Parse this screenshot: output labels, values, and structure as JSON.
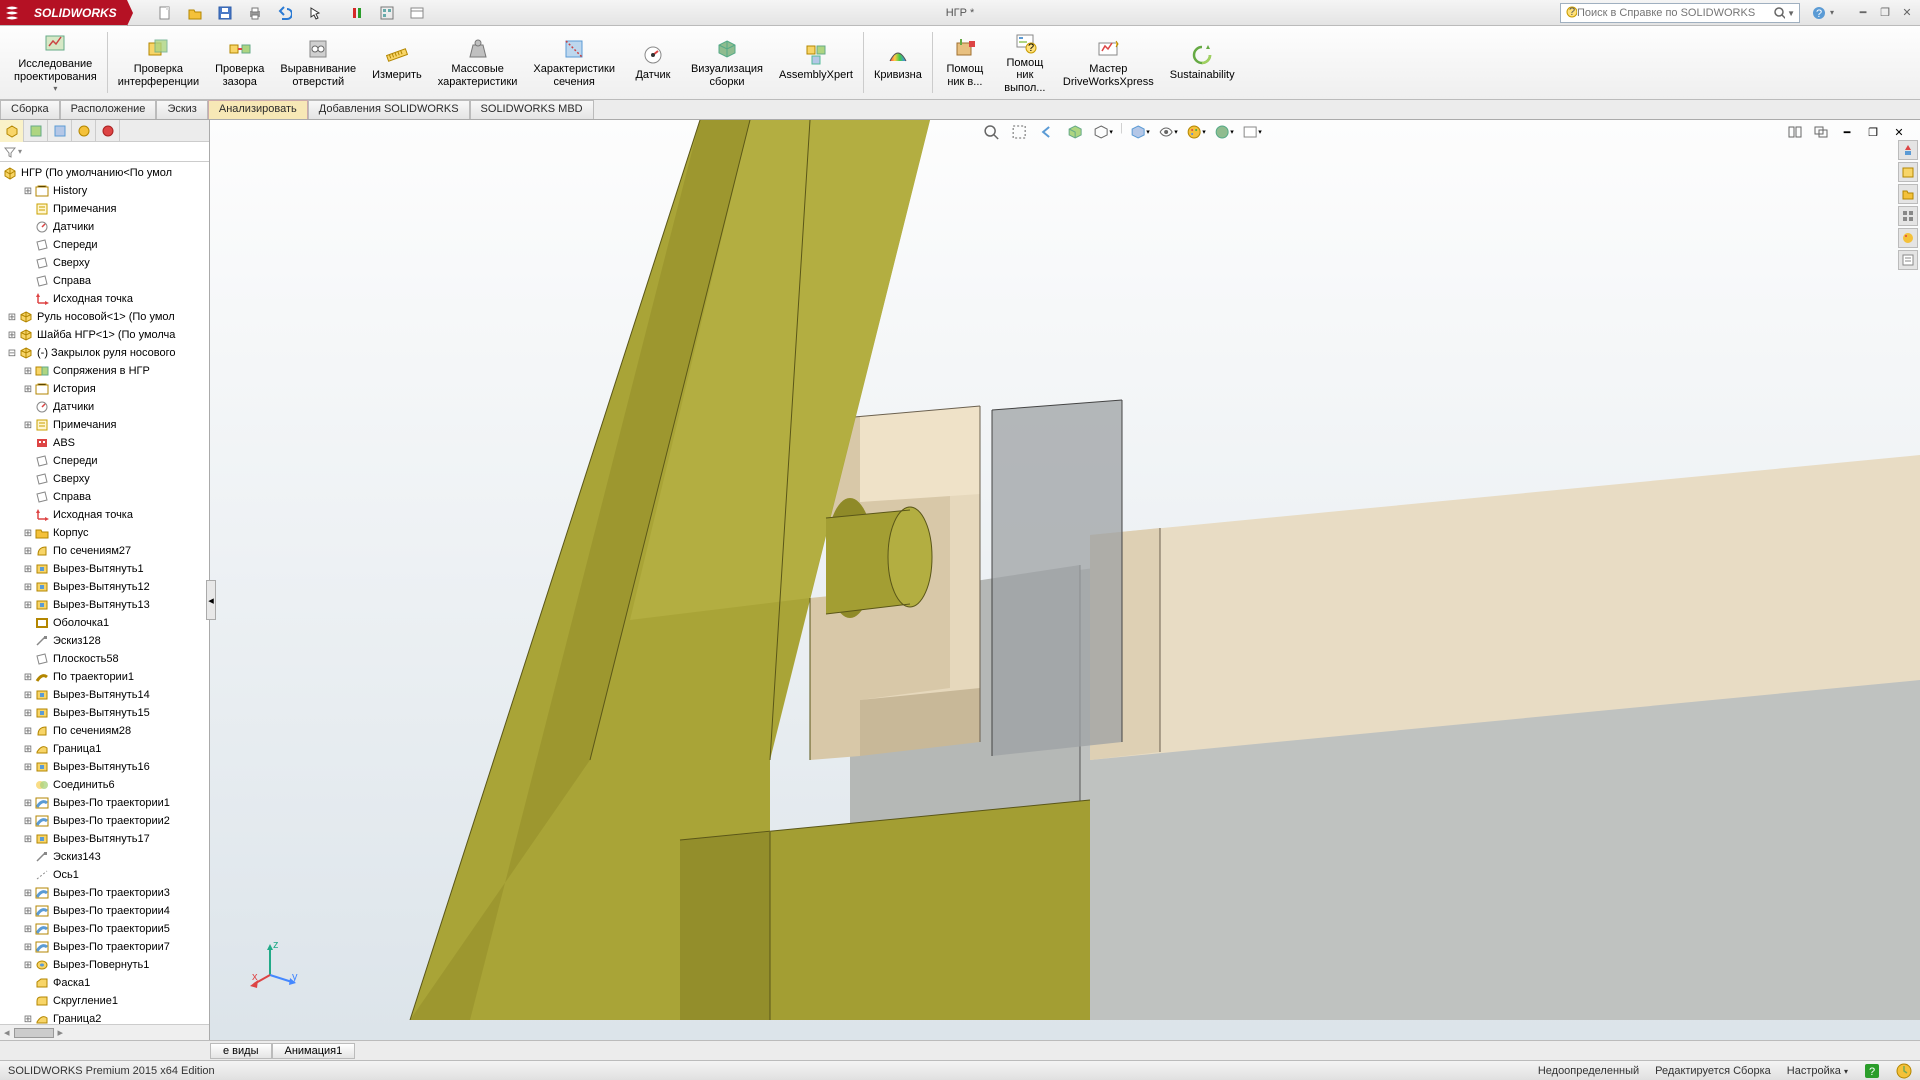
{
  "app": {
    "brand": "SOLIDWORKS",
    "doc_title": "НГР *"
  },
  "search": {
    "placeholder": "Поиск в Справке по SOLIDWORKS"
  },
  "ribbon": {
    "items": [
      {
        "label1": "Исследование",
        "label2": "проектирования",
        "icon": "design-study"
      },
      {
        "label1": "Проверка",
        "label2": "интерференции",
        "icon": "interference"
      },
      {
        "label1": "Проверка",
        "label2": "зазора",
        "icon": "clearance"
      },
      {
        "label1": "Выравнивание",
        "label2": "отверстий",
        "icon": "hole-align"
      },
      {
        "label1": "Измерить",
        "label2": "",
        "icon": "measure"
      },
      {
        "label1": "Массовые",
        "label2": "характеристики",
        "icon": "mass"
      },
      {
        "label1": "Характеристики",
        "label2": "сечения",
        "icon": "section"
      },
      {
        "label1": "Датчик",
        "label2": "",
        "icon": "sensor"
      },
      {
        "label1": "Визуализация",
        "label2": "сборки",
        "icon": "visualize"
      },
      {
        "label1": "AssemblyXpert",
        "label2": "",
        "icon": "asmxpert"
      },
      {
        "label1": "Кривизна",
        "label2": "",
        "icon": "curvature"
      },
      {
        "label1": "Помощ",
        "label2": "ник в...",
        "icon": "helper1"
      },
      {
        "label1": "Помощ",
        "label2": "ник",
        "label3": "выпол...",
        "icon": "helper2"
      },
      {
        "label1": "Мастер",
        "label2": "DriveWorksXpress",
        "icon": "dwx"
      },
      {
        "label1": "Sustainability",
        "label2": "",
        "icon": "sustain"
      }
    ]
  },
  "ribbon_tabs": [
    "Сборка",
    "Расположение",
    "Эскиз",
    "Анализировать",
    "Добавления SOLIDWORKS",
    "SOLIDWORKS MBD"
  ],
  "ribbon_tabs_active": 3,
  "tree": {
    "root": "НГР  (По умолчанию<По умол",
    "items": [
      {
        "pad": 1,
        "exp": "+",
        "icon": "history",
        "label": "History"
      },
      {
        "pad": 1,
        "exp": "",
        "icon": "note",
        "label": "Примечания"
      },
      {
        "pad": 1,
        "exp": "",
        "icon": "sensor",
        "label": "Датчики"
      },
      {
        "pad": 1,
        "exp": "",
        "icon": "plane",
        "label": "Спереди"
      },
      {
        "pad": 1,
        "exp": "",
        "icon": "plane",
        "label": "Сверху"
      },
      {
        "pad": 1,
        "exp": "",
        "icon": "plane",
        "label": "Справа"
      },
      {
        "pad": 1,
        "exp": "",
        "icon": "origin",
        "label": "Исходная точка"
      },
      {
        "pad": 0,
        "exp": "+",
        "icon": "part",
        "label": "Руль носовой<1> (По умол"
      },
      {
        "pad": 0,
        "exp": "+",
        "icon": "part",
        "label": "Шайба НГР<1> (По умолча"
      },
      {
        "pad": 0,
        "exp": "-",
        "icon": "part",
        "label": "(-) Закрылок руля носового"
      },
      {
        "pad": 1,
        "exp": "+",
        "icon": "mates",
        "label": "Сопряжения в НГР"
      },
      {
        "pad": 1,
        "exp": "+",
        "icon": "history",
        "label": "История"
      },
      {
        "pad": 1,
        "exp": "",
        "icon": "sensor",
        "label": "Датчики"
      },
      {
        "pad": 1,
        "exp": "+",
        "icon": "note",
        "label": "Примечания"
      },
      {
        "pad": 1,
        "exp": "",
        "icon": "material",
        "label": "ABS"
      },
      {
        "pad": 1,
        "exp": "",
        "icon": "plane",
        "label": "Спереди"
      },
      {
        "pad": 1,
        "exp": "",
        "icon": "plane",
        "label": "Сверху"
      },
      {
        "pad": 1,
        "exp": "",
        "icon": "plane",
        "label": "Справа"
      },
      {
        "pad": 1,
        "exp": "",
        "icon": "origin",
        "label": "Исходная точка"
      },
      {
        "pad": 1,
        "exp": "+",
        "icon": "folder",
        "label": "Корпус"
      },
      {
        "pad": 1,
        "exp": "+",
        "icon": "loft",
        "label": "По сечениям27"
      },
      {
        "pad": 1,
        "exp": "+",
        "icon": "cut",
        "label": "Вырез-Вытянуть1"
      },
      {
        "pad": 1,
        "exp": "+",
        "icon": "cut",
        "label": "Вырез-Вытянуть12"
      },
      {
        "pad": 1,
        "exp": "+",
        "icon": "cut",
        "label": "Вырез-Вытянуть13"
      },
      {
        "pad": 1,
        "exp": "",
        "icon": "shell",
        "label": "Оболочка1"
      },
      {
        "pad": 1,
        "exp": "",
        "icon": "sketch",
        "label": "Эскиз128"
      },
      {
        "pad": 1,
        "exp": "",
        "icon": "plane",
        "label": "Плоскость58"
      },
      {
        "pad": 1,
        "exp": "+",
        "icon": "sweep",
        "label": "По траектории1"
      },
      {
        "pad": 1,
        "exp": "+",
        "icon": "cut",
        "label": "Вырез-Вытянуть14"
      },
      {
        "pad": 1,
        "exp": "+",
        "icon": "cut",
        "label": "Вырез-Вытянуть15"
      },
      {
        "pad": 1,
        "exp": "+",
        "icon": "loft",
        "label": "По сечениям28"
      },
      {
        "pad": 1,
        "exp": "+",
        "icon": "boundary",
        "label": "Граница1"
      },
      {
        "pad": 1,
        "exp": "+",
        "icon": "cut",
        "label": "Вырез-Вытянуть16"
      },
      {
        "pad": 1,
        "exp": "",
        "icon": "combine",
        "label": "Соединить6"
      },
      {
        "pad": 1,
        "exp": "+",
        "icon": "sweepcut",
        "label": "Вырез-По траектории1"
      },
      {
        "pad": 1,
        "exp": "+",
        "icon": "sweepcut",
        "label": "Вырез-По траектории2"
      },
      {
        "pad": 1,
        "exp": "+",
        "icon": "cut",
        "label": "Вырез-Вытянуть17"
      },
      {
        "pad": 1,
        "exp": "",
        "icon": "sketch",
        "label": "Эскиз143"
      },
      {
        "pad": 1,
        "exp": "",
        "icon": "axis",
        "label": "Ось1"
      },
      {
        "pad": 1,
        "exp": "+",
        "icon": "sweepcut",
        "label": "Вырез-По траектории3"
      },
      {
        "pad": 1,
        "exp": "+",
        "icon": "sweepcut",
        "label": "Вырез-По траектории4"
      },
      {
        "pad": 1,
        "exp": "+",
        "icon": "sweepcut",
        "label": "Вырез-По траектории5"
      },
      {
        "pad": 1,
        "exp": "+",
        "icon": "sweepcut",
        "label": "Вырез-По траектории7"
      },
      {
        "pad": 1,
        "exp": "+",
        "icon": "revolvecut",
        "label": "Вырез-Повернуть1"
      },
      {
        "pad": 1,
        "exp": "",
        "icon": "chamfer",
        "label": "Фаска1"
      },
      {
        "pad": 1,
        "exp": "",
        "icon": "fillet",
        "label": "Скругление1"
      },
      {
        "pad": 1,
        "exp": "+",
        "icon": "boundary",
        "label": "Граница2"
      }
    ]
  },
  "bottom_tabs": [
    "е виды",
    "Анимация1"
  ],
  "status": {
    "left": "SOLIDWORKS Premium 2015 x64 Edition",
    "under": "Недоопределенный",
    "edit": "Редактируется Сборка",
    "custom": "Настройка"
  }
}
